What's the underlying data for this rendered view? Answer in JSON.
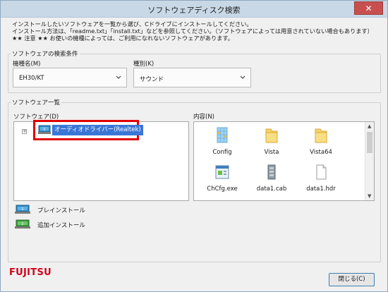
{
  "window": {
    "title": "ソフトウェアディスク検索",
    "close_glyph": "✕"
  },
  "info": {
    "line1": "インストールしたいソフトウェアを一覧から選び、Cドライブにインストールしてください。",
    "line2": "インストール方法は、「readme.txt」「install.txt」などを参照してください。（ソフトウェアによっては用意されていない場合もあります）",
    "line3": "★★ 注意 ★★ お使いの機種によっては、ご利用になれないソフトウェアがあります。"
  },
  "search": {
    "group_title": "ソフトウェアの検索条件",
    "model_label": "機種名(M)",
    "model_value": "EH30/KT",
    "type_label": "種別(K)",
    "type_value": "サウンド"
  },
  "list": {
    "group_title": "ソフトウェア一覧",
    "software_label": "ソフトウェア(D)",
    "contents_label": "内容(N)",
    "tree_items": [
      {
        "label": "オーディオドライバー(Realtek)"
      }
    ],
    "files": [
      {
        "name": "Config",
        "icon": "folder-grid"
      },
      {
        "name": "Vista",
        "icon": "folder"
      },
      {
        "name": "Vista64",
        "icon": "folder"
      },
      {
        "name": "ChCfg.exe",
        "icon": "exe"
      },
      {
        "name": "data1.cab",
        "icon": "cab"
      },
      {
        "name": "data1.hdr",
        "icon": "document"
      }
    ]
  },
  "legend": {
    "pre_install": "プレインストール",
    "add_install": "追加インストール"
  },
  "footer": {
    "brand": "FUJITSU",
    "close_button": "閉じる(C)"
  },
  "colors": {
    "accent": "#3a76d6",
    "highlight": "#e00000",
    "brand": "#d0021b"
  }
}
